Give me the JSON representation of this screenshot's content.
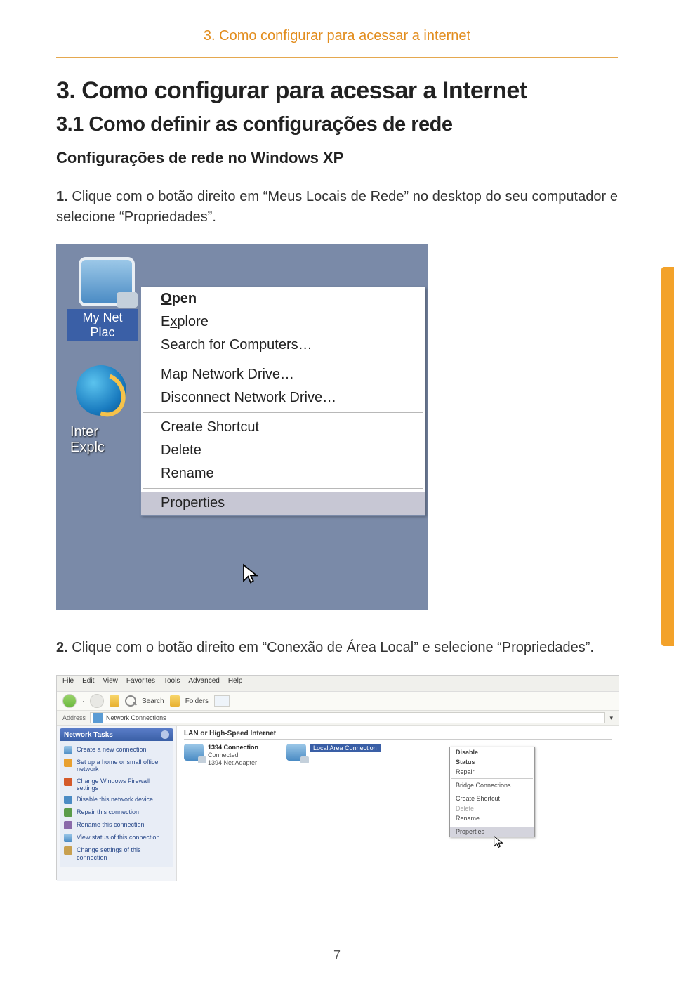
{
  "page": {
    "running_head": "3. Como configurar para acessar a internet",
    "h1": "3. Como configurar para acessar a Internet",
    "h2": "3.1 Como definir as configurações de rede",
    "h3": "Configurações de rede no Windows XP",
    "step1_n": "1.",
    "step1": " Clique com o botão direito em “Meus Locais de Rede” no desktop do seu computador e selecione “Propriedades”.",
    "step2_n": "2.",
    "step2": " Clique com o botão direito em “Conexão de Área Local” e selecione “Propriedades”.",
    "page_number": "7"
  },
  "shot1": {
    "icon_label_1a": "My Net",
    "icon_label_1b": "Plac",
    "icon_label_2a": "Inter",
    "icon_label_2b": "Explc",
    "menu": {
      "open": "Open",
      "explore": "Explore",
      "search": "Search for Computers…",
      "map": "Map Network Drive…",
      "disconnect": "Disconnect Network Drive…",
      "shortcut": "Create Shortcut",
      "delete": "Delete",
      "rename": "Rename",
      "properties": "Properties"
    }
  },
  "shot2": {
    "menubar": [
      "File",
      "Edit",
      "View",
      "Favorites",
      "Tools",
      "Advanced",
      "Help"
    ],
    "toolbar": {
      "search": "Search",
      "folders": "Folders"
    },
    "address_label": "Address",
    "address_value": "Network Connections",
    "tasks_header": "Network Tasks",
    "tasks": [
      "Create a new connection",
      "Set up a home or small office network",
      "Change Windows Firewall settings",
      "Disable this network device",
      "Repair this connection",
      "Rename this connection",
      "View status of this connection",
      "Change settings of this connection"
    ],
    "section": "LAN or High-Speed Internet",
    "conn1": {
      "name": "1394 Connection",
      "status": "Connected",
      "adapter": "1394 Net Adapter"
    },
    "conn2": {
      "name": "Local Area Connection"
    },
    "ctx": {
      "disable": "Disable",
      "status": "Status",
      "repair": "Repair",
      "bridge": "Bridge Connections",
      "shortcut": "Create Shortcut",
      "delete": "Delete",
      "rename": "Rename",
      "properties": "Properties"
    }
  }
}
